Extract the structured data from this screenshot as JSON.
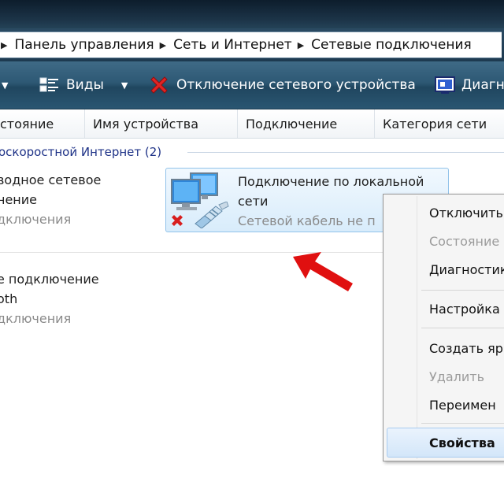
{
  "address": {
    "crumbs": [
      "Панель управления",
      "Сеть и Интернет",
      "Сетевые подключения"
    ]
  },
  "toolbar": {
    "views_label": "Виды",
    "disable_label": "Отключение сетевого устройства",
    "diagnose_label": "Диагн"
  },
  "columns": [
    "стояние",
    "Имя устройства",
    "Подключение",
    "Категория сети"
  ],
  "group": {
    "title": "оскоростной Интернет (2)"
  },
  "items": [
    {
      "line1": "водное сетевое",
      "line2": "нение",
      "status": "дключения"
    },
    {
      "line1": "Подключение по локальной",
      "line2": "сети",
      "status": "Сетевой кабель не п"
    },
    {
      "line1": "е подключение",
      "line2": "oth",
      "status": "дключения"
    }
  ],
  "context_menu": {
    "items": [
      {
        "label": "Отключить",
        "disabled": false
      },
      {
        "label": "Состояние",
        "disabled": true
      },
      {
        "label": "Диагностика",
        "disabled": false
      },
      {
        "label": "Настройка",
        "disabled": false
      },
      {
        "label": "Создать яр",
        "disabled": false
      },
      {
        "label": "Удалить",
        "disabled": true
      },
      {
        "label": "Переимен",
        "disabled": false
      },
      {
        "label": "Свойства",
        "disabled": false
      }
    ]
  },
  "colors": {
    "toolbar": "#2d5874",
    "group_title": "#1e3287",
    "arrow": "#e01010",
    "error_x": "#d81e1e"
  },
  "icons": [
    "chevron-right-icon",
    "views-icon",
    "red-x-icon",
    "diagnose-icon",
    "network-computers-icon",
    "ethernet-plug-icon",
    "red-arrow"
  ]
}
